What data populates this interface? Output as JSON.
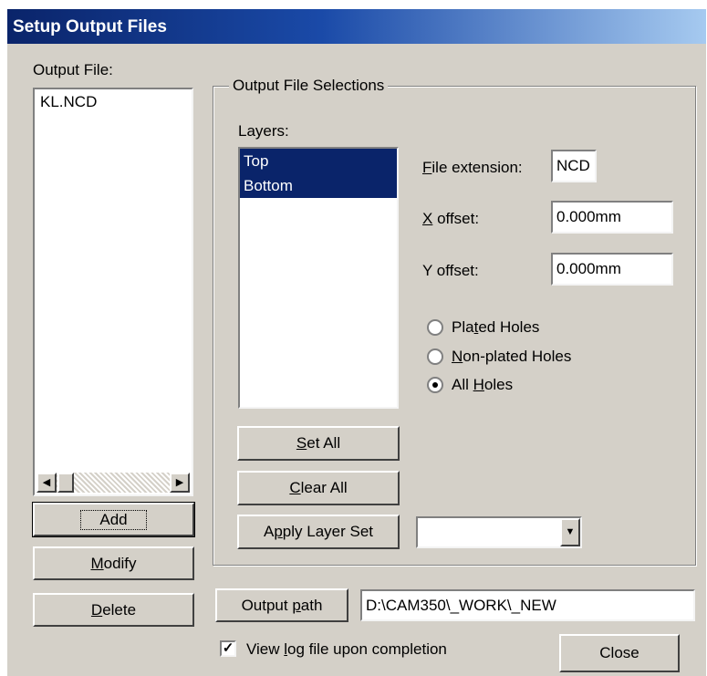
{
  "window": {
    "title": "Setup Output Files"
  },
  "output_file": {
    "label": "Output File:",
    "items": [
      "KL.NCD"
    ],
    "scroll_left_icon": "arrow-left",
    "scroll_right_icon": "arrow-right"
  },
  "buttons": {
    "add": "Add",
    "modify_pre": "",
    "modify_acc": "M",
    "modify_post": "odify",
    "delete_pre": "",
    "delete_acc": "D",
    "delete_post": "elete",
    "set_all_pre": "",
    "set_all_acc": "S",
    "set_all_post": "et All",
    "clear_all_pre": "",
    "clear_all_acc": "C",
    "clear_all_post": "lear All",
    "apply_pre": "A",
    "apply_acc": "p",
    "apply_post": "ply Layer Set",
    "output_path_pre": "Output ",
    "output_path_acc": "p",
    "output_path_post": "ath",
    "close": "Close"
  },
  "selections": {
    "group_title": "Output File Selections",
    "layers_label": "Layers:",
    "layers": [
      {
        "label": "Top",
        "selected": true
      },
      {
        "label": "Bottom",
        "selected": true
      }
    ],
    "file_extension": {
      "label_acc": "F",
      "label_post": "ile extension:",
      "value": "NCD"
    },
    "x_offset": {
      "label_acc": "X",
      "label_post": " offset:",
      "value": "0.000mm"
    },
    "y_offset": {
      "label": "Y offset:",
      "value": "0.000mm"
    },
    "holes": {
      "plated": {
        "pre": "Pla",
        "acc": "t",
        "post": "ed Holes",
        "checked": false
      },
      "non_plated": {
        "pre": "",
        "acc": "N",
        "post": "on-plated Holes",
        "checked": false
      },
      "all": {
        "pre": "All ",
        "acc": "H",
        "post": "oles",
        "checked": true
      }
    },
    "layer_set_value": ""
  },
  "output_path": {
    "value": "D:\\CAM350\\_WORK\\_NEW"
  },
  "view_log": {
    "pre": "View ",
    "acc": "l",
    "post": "og file upon completion",
    "checked": true
  },
  "colors": {
    "titlebar": "#0a246a",
    "face": "#d4d0c8",
    "selection": "#0a246a"
  }
}
